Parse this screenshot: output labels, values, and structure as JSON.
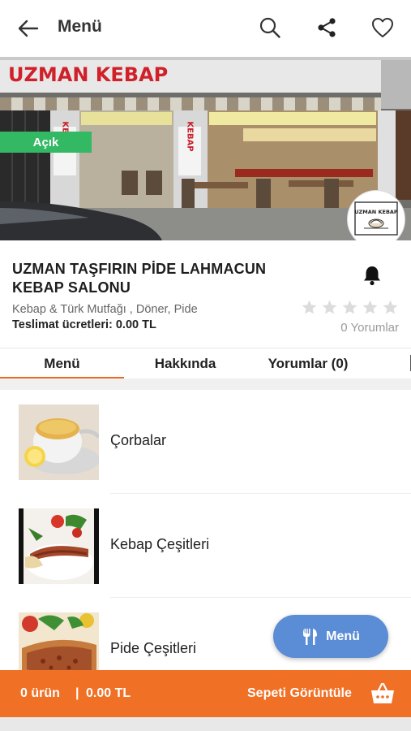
{
  "header": {
    "title": "Menü",
    "icons": [
      "back-arrow-icon",
      "search-icon",
      "share-icon",
      "heart-icon"
    ]
  },
  "hero": {
    "status_badge": "Açık",
    "sign_text": "UZMAN KEBAP",
    "vertical_sign": "KEBAP",
    "logo_text": "UZMAN KEBAP"
  },
  "restaurant": {
    "name": "UZMAN TAŞFIRIN PİDE LAHMACUN KEBAP SALONU",
    "cuisine": "Kebap & Türk Mutfağı , Döner, Pide",
    "delivery_fee": "Teslimat ücretleri: 0.00 TL",
    "rating": 0,
    "max_rating": 5,
    "reviews": "0 Yorumlar"
  },
  "tabs": {
    "menu": "Menü",
    "about": "Hakkında",
    "reviews": "Yorumlar (0)",
    "active": "menu"
  },
  "categories": [
    {
      "label": "Çorbalar",
      "image": "soup-image"
    },
    {
      "label": "Kebap Çeşitleri",
      "image": "kebab-image"
    },
    {
      "label": "Pide Çeşitleri",
      "image": "pide-image"
    }
  ],
  "fab": {
    "label": "Menü",
    "icon": "cutlery-icon"
  },
  "cart": {
    "count": "0 ürün",
    "separator": "|",
    "total": "0.00 TL",
    "view_label": "Sepeti Görüntüle",
    "icon": "basket-icon"
  },
  "colors": {
    "accent": "#f07025",
    "open_badge": "#33b863",
    "fab": "#5b8dd6",
    "star_empty": "#dddddd"
  }
}
